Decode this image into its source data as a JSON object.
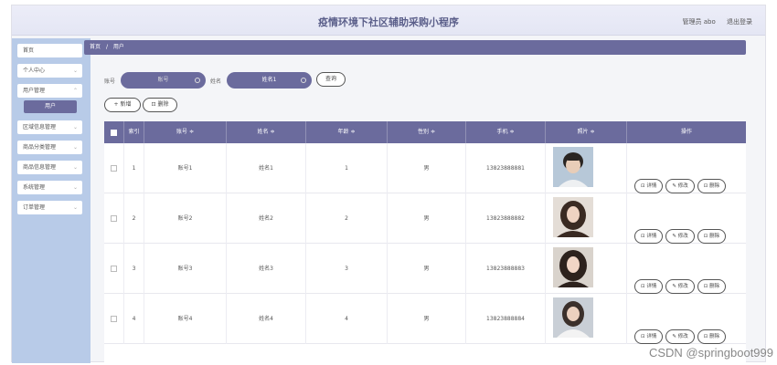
{
  "header": {
    "title": "疫情环境下社区辅助采购小程序",
    "user_label": "管理员 abo",
    "logout_label": "退出登录"
  },
  "sidebar": {
    "items": [
      {
        "label": "首页",
        "has_chevron": false
      },
      {
        "label": "个人中心",
        "has_chevron": true
      },
      {
        "label": "用户管理",
        "has_chevron": true
      },
      {
        "label": "区域信息管理",
        "has_chevron": true
      },
      {
        "label": "商品分类管理",
        "has_chevron": true
      },
      {
        "label": "商品信息管理",
        "has_chevron": true
      },
      {
        "label": "系统管理",
        "has_chevron": true
      },
      {
        "label": "订单管理",
        "has_chevron": true
      }
    ],
    "active_sub": "用户"
  },
  "breadcrumb": {
    "home": "首页",
    "sep": "/",
    "current": "用户"
  },
  "search": {
    "account_label": "账号",
    "account_placeholder": "账号",
    "name_label": "姓名",
    "name_value": "姓名1",
    "query_button": "查询"
  },
  "toolbar": {
    "add_label": "+ 新增",
    "delete_label": "删除"
  },
  "table": {
    "headers": [
      "",
      "索引",
      "账号 ≑",
      "姓名 ≑",
      "年龄 ≑",
      "性别 ≑",
      "手机 ≑",
      "照片 ≑",
      "操作"
    ],
    "rows": [
      {
        "index": "1",
        "account": "账号1",
        "name": "姓名1",
        "age": "1",
        "gender": "男",
        "phone": "13823888881"
      },
      {
        "index": "2",
        "account": "账号2",
        "name": "姓名2",
        "age": "2",
        "gender": "男",
        "phone": "13823888882"
      },
      {
        "index": "3",
        "account": "账号3",
        "name": "姓名3",
        "age": "3",
        "gender": "男",
        "phone": "13823888883"
      },
      {
        "index": "4",
        "account": "账号4",
        "name": "姓名4",
        "age": "4",
        "gender": "男",
        "phone": "13823888884"
      }
    ],
    "actions": {
      "detail": "详情",
      "edit": "修改",
      "delete": "删除"
    }
  },
  "watermark": "CSDN @springboot999",
  "colors": {
    "accent": "#6b6b9d",
    "sidebar": "#b8cbe8"
  }
}
